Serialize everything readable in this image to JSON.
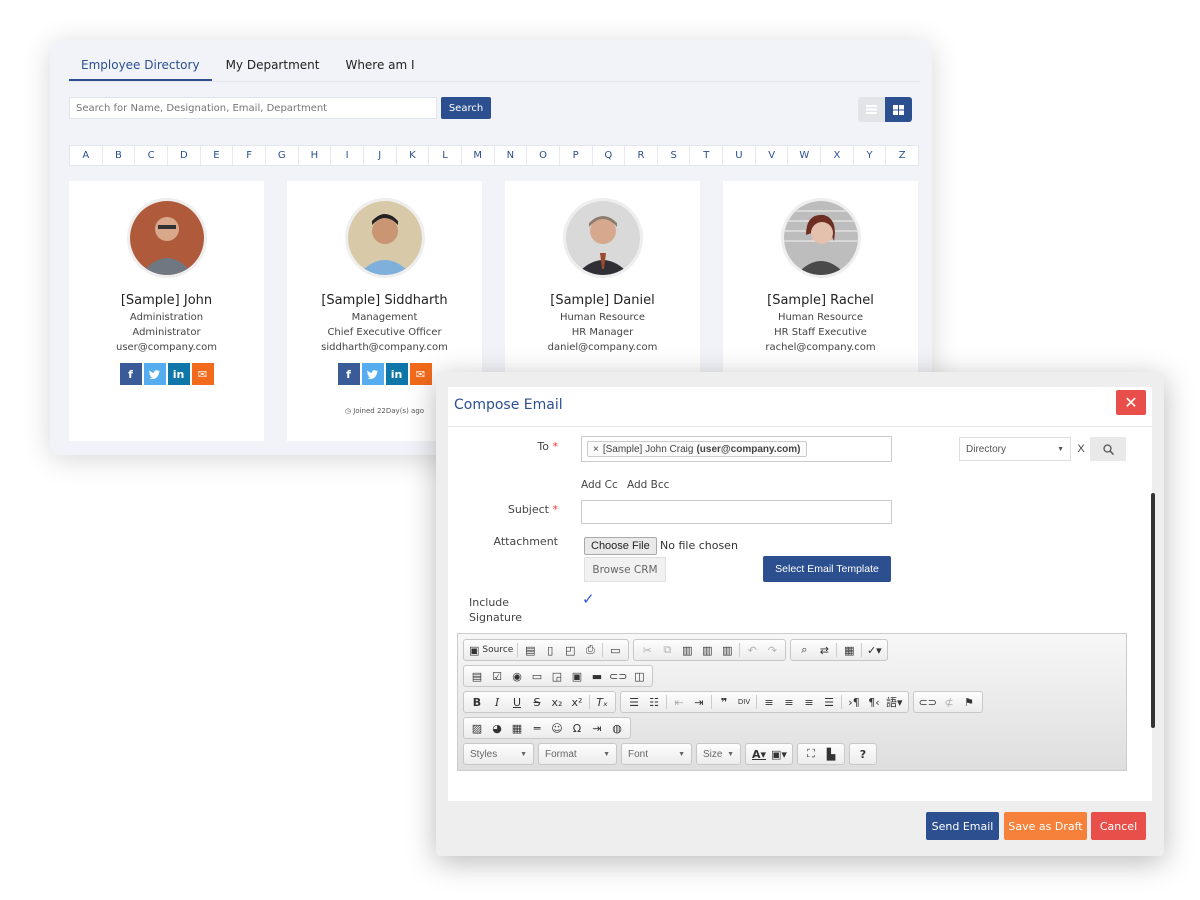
{
  "directory": {
    "tabs": [
      {
        "label": "Employee Directory",
        "active": true
      },
      {
        "label": "My Department",
        "active": false
      },
      {
        "label": "Where am I",
        "active": false
      }
    ],
    "search": {
      "placeholder": "Search for Name, Designation, Email, Department",
      "value": "",
      "button_label": "Search"
    },
    "view_toggle": {
      "list_icon": "list-icon",
      "grid_icon": "grid-icon",
      "active": "grid"
    },
    "alphabet": [
      "A",
      "B",
      "C",
      "D",
      "E",
      "F",
      "G",
      "H",
      "I",
      "J",
      "K",
      "L",
      "M",
      "N",
      "O",
      "P",
      "Q",
      "R",
      "S",
      "T",
      "U",
      "V",
      "W",
      "X",
      "Y",
      "Z"
    ],
    "employees": [
      {
        "name": "[Sample] John",
        "department": "Administration",
        "designation": "Administrator",
        "email": "user@company.com",
        "joined": ""
      },
      {
        "name": "[Sample] Siddharth",
        "department": "Management",
        "designation": "Chief Executive Officer",
        "email": "siddharth@company.com",
        "joined": "Joined 22Day(s) ago"
      },
      {
        "name": "[Sample] Daniel",
        "department": "Human Resource",
        "designation": "HR Manager",
        "email": "daniel@company.com",
        "joined": ""
      },
      {
        "name": "[Sample] Rachel",
        "department": "Human Resource",
        "designation": "HR Staff Executive",
        "email": "rachel@company.com",
        "joined": ""
      }
    ],
    "social": {
      "facebook": "f",
      "twitter": "t",
      "linkedin": "in",
      "email": "✉"
    }
  },
  "compose": {
    "title": "Compose Email",
    "close_label": "✕",
    "to_label": "To",
    "required_mark": "*",
    "to_chip_name": "[Sample] John Craig",
    "to_chip_email": "(user@company.com)",
    "chip_remove": "×",
    "directory_select": "Directory",
    "directory_clear": "X",
    "add_cc": "Add Cc",
    "add_bcc": "Add Bcc",
    "subject_label": "Subject",
    "subject_value": "",
    "attachment_label": "Attachment",
    "choose_file": "Choose File",
    "no_file": "No file chosen",
    "browse_crm": "Browse CRM",
    "select_template": "Select Email Template",
    "include_signature": "Include Signature",
    "signature_checked": true,
    "toolbar": {
      "source": "Source",
      "styles": "Styles",
      "format": "Format",
      "font": "Font",
      "size": "Size",
      "help": "?"
    },
    "buttons": {
      "send": "Send Email",
      "draft": "Save as Draft",
      "cancel": "Cancel"
    },
    "colors": {
      "primary": "#2c4f8f",
      "draft": "#f5813a",
      "cancel": "#e84e4a"
    }
  }
}
